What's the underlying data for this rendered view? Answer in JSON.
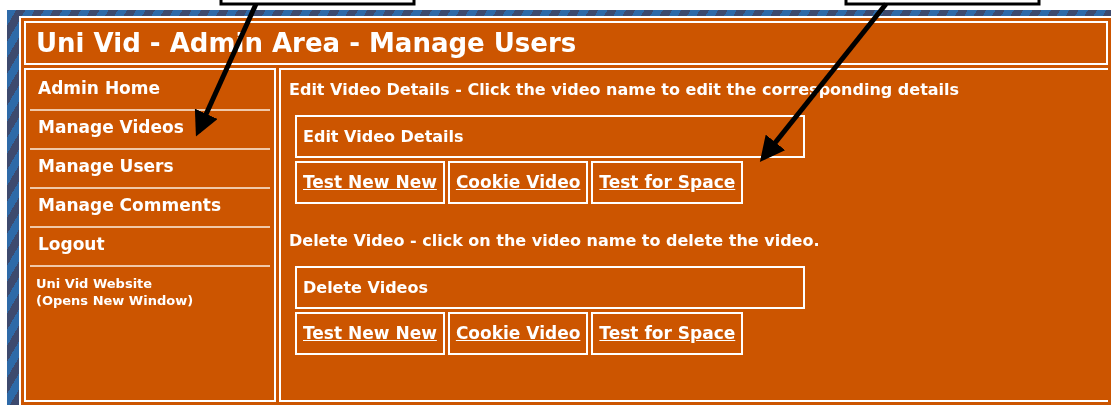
{
  "title": "Uni Vid - Admin Area - Manage Users",
  "nav": [
    {
      "label": "Admin Home",
      "kind": "main"
    },
    {
      "label": "Manage Videos",
      "kind": "main"
    },
    {
      "label": "Manage Users",
      "kind": "main"
    },
    {
      "label": "Manage Comments",
      "kind": "main"
    },
    {
      "label": "Logout",
      "kind": "main"
    },
    {
      "label": "Uni Vid Website\n(Opens New Window)",
      "kind": "small"
    }
  ],
  "sections": [
    {
      "intro": "Edit Video Details - Click the video name to edit the corresponding details",
      "caption": "Edit Video Details",
      "links": [
        "Test New New",
        "Cookie Video",
        "Test for Space"
      ]
    },
    {
      "intro": "Delete Video - click on the video name to delete the video.",
      "caption": "Delete Videos",
      "links": [
        "Test New New",
        "Cookie Video",
        "Test for Space"
      ]
    }
  ]
}
